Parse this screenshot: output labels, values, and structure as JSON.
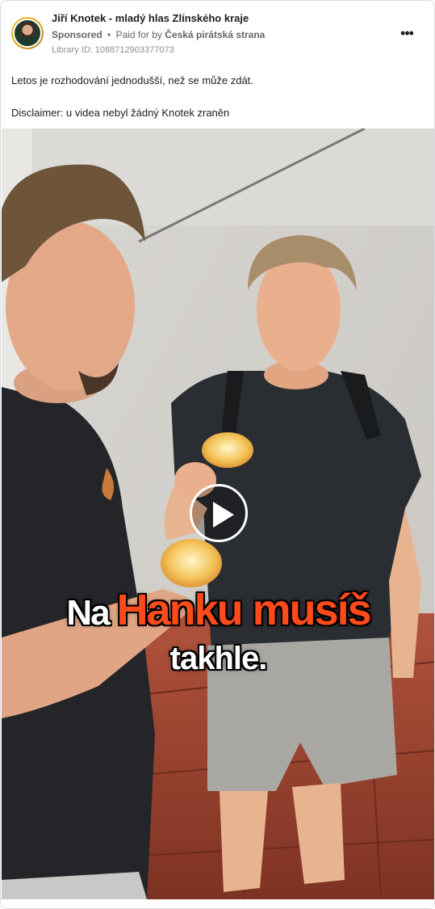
{
  "post": {
    "page_name": "Jiří Knotek - mladý hlas Zlínského kraje",
    "sponsored_label": "Sponsored",
    "separator": "•",
    "paid_for_prefix": "Paid for by",
    "payer": "Česká pirátská strana",
    "library_id": "Library ID: 1088712903377073",
    "more_icon": "more-horizontal-icon",
    "more_label": "•••",
    "body_lines": [
      "Letos je rozhodování jednodušší, než se může zdát.",
      "Disclaimer: u videa nebyl žádný Knotek zraněn"
    ]
  },
  "video": {
    "play_icon": "play-icon",
    "caption_word_1": "Na",
    "caption_words_2": "Hanku musíš",
    "caption_line_2": "takhle.",
    "caption_accent_color": "#ff4a1c"
  }
}
